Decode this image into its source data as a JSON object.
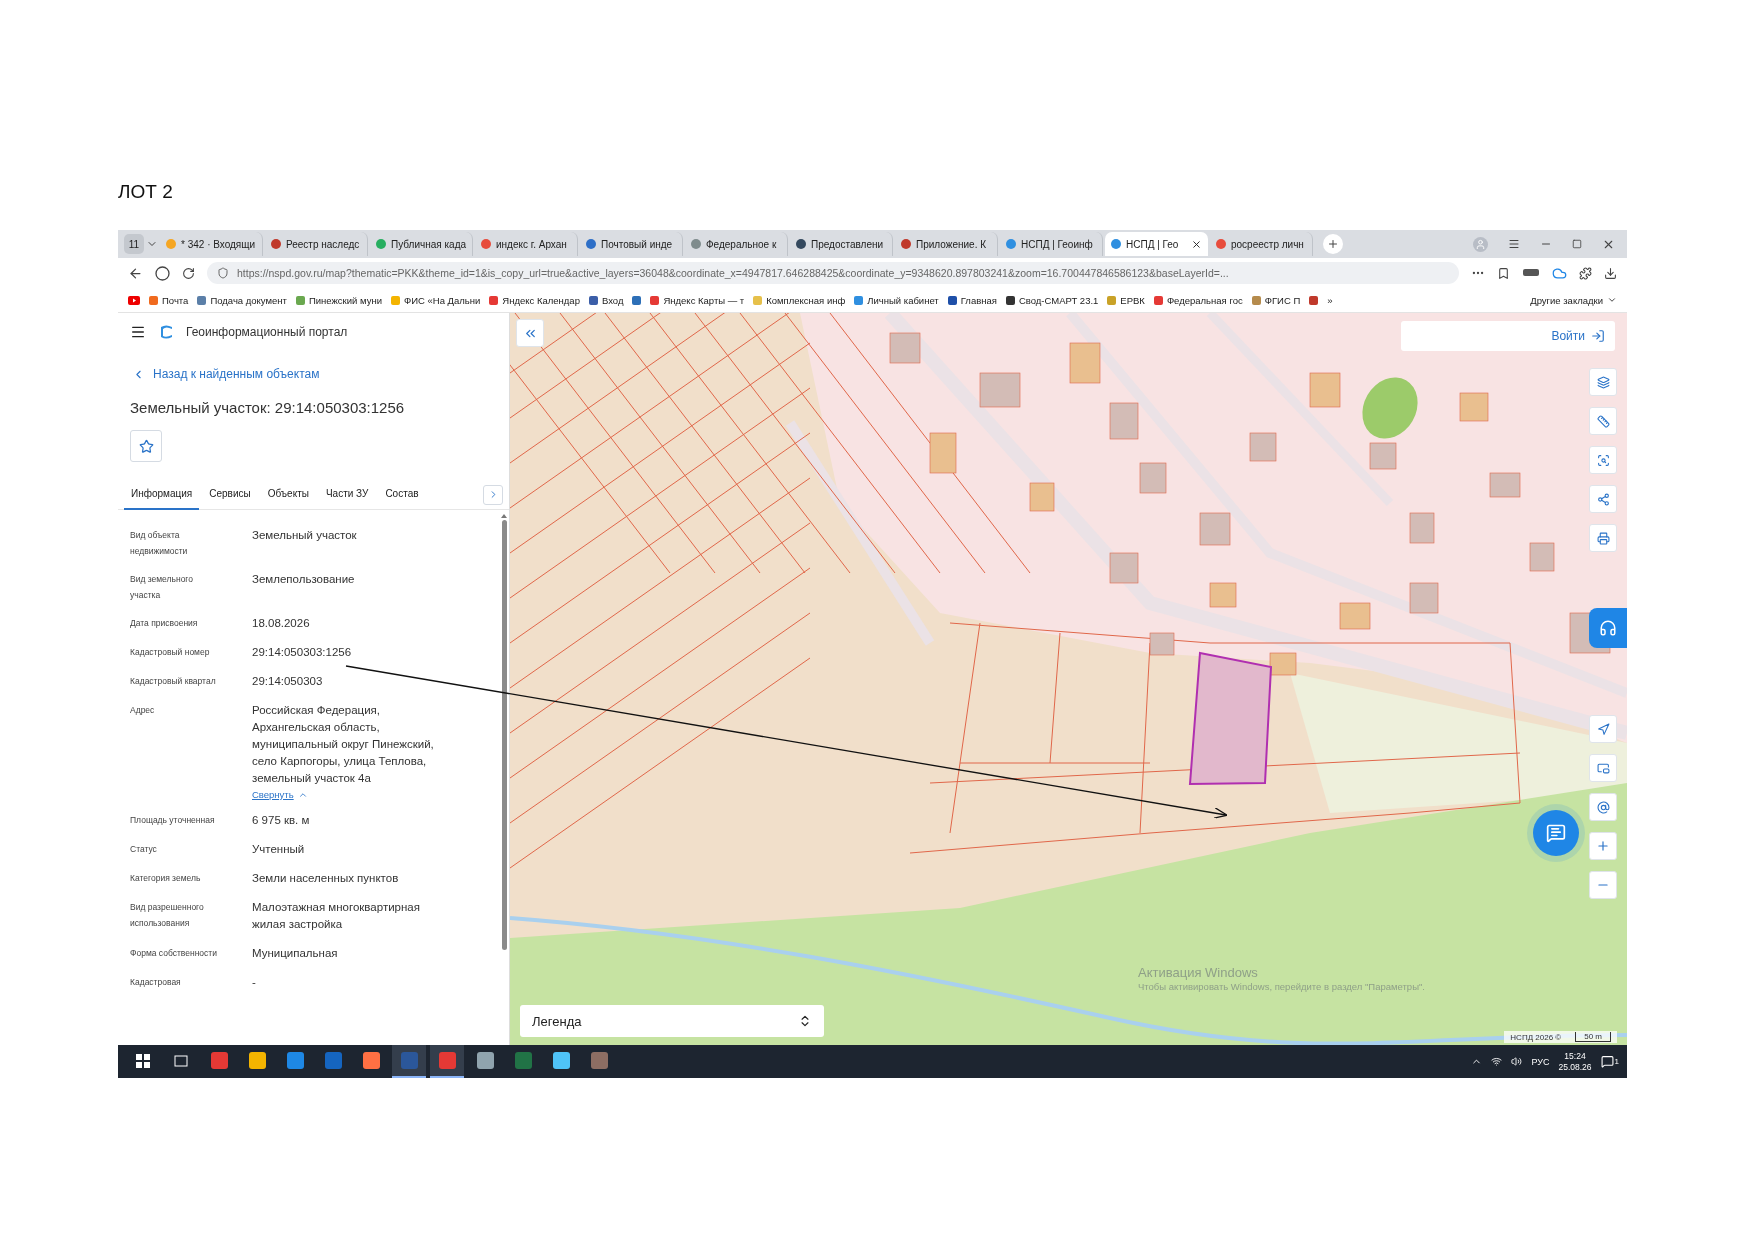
{
  "document": {
    "heading": "ЛОТ 2"
  },
  "browser": {
    "tab_count": "11",
    "tabs": [
      {
        "title": "* 342 · Входящи",
        "color": "#f5a623",
        "selected": false
      },
      {
        "title": "Реестр наследс",
        "color": "#c0392b",
        "selected": false
      },
      {
        "title": "Публичная када",
        "color": "#27ae60",
        "selected": false
      },
      {
        "title": "индекс г. Архан",
        "color": "#e74c3c",
        "selected": false
      },
      {
        "title": "Почтовый инде",
        "color": "#2e6fc7",
        "selected": false
      },
      {
        "title": "Федеральное к",
        "color": "#7f8c8d",
        "selected": false
      },
      {
        "title": "Предоставлени",
        "color": "#34495e",
        "selected": false
      },
      {
        "title": "Приложение. К",
        "color": "#c0392b",
        "selected": false
      },
      {
        "title": "НСПД | Геоинф",
        "color": "#2f8fe0",
        "selected": false
      },
      {
        "title": "НСПД | Гео",
        "color": "#2f8fe0",
        "selected": true
      },
      {
        "title": "росреестр личн",
        "color": "#e74c3c",
        "selected": false
      }
    ],
    "url": "https://nspd.gov.ru/map?thematic=PKK&theme_id=1&is_copy_url=true&active_layers=36048&coordinate_x=4947817.646288425&coordinate_y=9348620.897803241&zoom=16.700447846586123&baseLayerId=...",
    "bookmarks": [
      {
        "title": "Почта",
        "color": "#f06a1e"
      },
      {
        "title": "Подача документ",
        "color": "#5b7fa8"
      },
      {
        "title": "Пинежский муни",
        "color": "#6aa84f"
      },
      {
        "title": "ФИС «На Дальни",
        "color": "#f4b400"
      },
      {
        "title": "Яндекс Календар",
        "color": "#e53935"
      },
      {
        "title": "Вход",
        "color": "#3b5ea8"
      },
      {
        "color": "#2d6fb7"
      },
      {
        "title": "Яндекс Карты — т",
        "color": "#e53935"
      },
      {
        "title": "Комплексная инф",
        "color": "#e6c04a"
      },
      {
        "title": "Личный кабинет",
        "color": "#2f8fe0"
      },
      {
        "title": "Главная",
        "color": "#1e4fa8"
      },
      {
        "title": "Свод-СМАРТ 23.1",
        "color": "#333333"
      },
      {
        "title": "ЕРВК",
        "color": "#c9a227"
      },
      {
        "title": "Федеральная гос",
        "color": "#e53935"
      },
      {
        "title": "ФГИС П",
        "color": "#b58b4c"
      },
      {
        "color": "#c0392b"
      }
    ],
    "overflow": "»",
    "other_bookmarks": "Другие закладки"
  },
  "portal": {
    "title": "Геоинформационный портал",
    "back_link": "Назад к найденным объектам",
    "heading": "Земельный участок: 29:14:050303:1256",
    "tabs": [
      {
        "label": "Информация",
        "selected": true
      },
      {
        "label": "Сервисы",
        "selected": false
      },
      {
        "label": "Объекты",
        "selected": false
      },
      {
        "label": "Части ЗУ",
        "selected": false
      },
      {
        "label": "Состав",
        "selected": false
      }
    ],
    "fields": [
      {
        "label": "Вид объекта недвижимости",
        "value": "Земельный участок"
      },
      {
        "label": "Вид земельного участка",
        "value": "Землепользование"
      },
      {
        "label": "Дата присвоения",
        "value": "18.08.2026"
      },
      {
        "label": "Кадастровый номер",
        "value": "29:14:050303:1256"
      },
      {
        "label": "Кадастровый квартал",
        "value": "29:14:050303"
      },
      {
        "label": "Адрес",
        "value": "Российская Федерация, Архангельская область, муниципальный округ Пинежский, село Карпогоры, улица Теплова, земельный участок 4а",
        "link": "Свернуть"
      },
      {
        "label": "Площадь уточненная",
        "value": "6 975 кв. м"
      },
      {
        "label": "Статус",
        "value": "Учтенный"
      },
      {
        "label": "Категория земель",
        "value": "Земли населенных пунктов"
      },
      {
        "label": "Вид разрешенного использования",
        "value": "Малоэтажная многоквартирная жилая застройка"
      },
      {
        "label": "Форма собственности",
        "value": "Муниципальная"
      },
      {
        "label": "Кадастровая",
        "value": "-"
      }
    ]
  },
  "map": {
    "login": "Войти",
    "legend": "Легенда",
    "attribution": "НСПД 2026 ©",
    "scale": "50 m"
  },
  "os_notice": {
    "title": "Активация Windows",
    "text": "Чтобы активировать Windows, перейдите в раздел \"Параметры\"."
  },
  "taskbar": {
    "apps": [
      {
        "color": "#e53935",
        "selected": false
      },
      {
        "color": "#f4b400",
        "selected": false
      },
      {
        "color": "#1e88e5",
        "selected": false
      },
      {
        "color": "#1565c0",
        "selected": false
      },
      {
        "color": "#ff7043",
        "selected": false
      },
      {
        "color": "#2b579a",
        "selected": true
      },
      {
        "color": "#e53935",
        "selected": true
      },
      {
        "color": "#90a4ae",
        "selected": false
      },
      {
        "color": "#217346",
        "selected": false
      },
      {
        "color": "#4fc3f7",
        "selected": false
      },
      {
        "color": "#8d6e63",
        "selected": false
      }
    ],
    "language": "РУС",
    "time": "15:24",
    "date": "25.08.26",
    "notification_count": "1"
  }
}
